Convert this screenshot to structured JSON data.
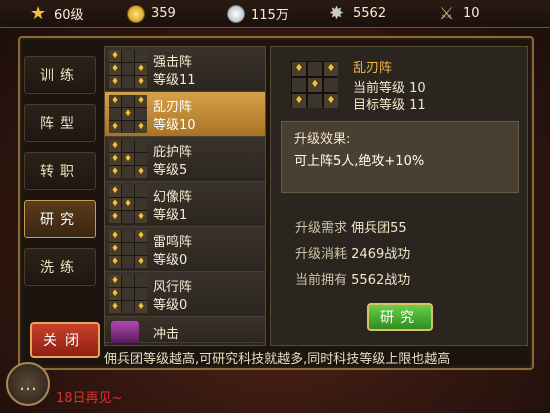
{
  "topbar": {
    "level": "60级",
    "gold": "359",
    "silver": "115万",
    "merit": "5562",
    "stamina": "10"
  },
  "tabs": [
    {
      "label": "训练",
      "active": false
    },
    {
      "label": "阵型",
      "active": false
    },
    {
      "label": "转职",
      "active": false
    },
    {
      "label": "研究",
      "active": true
    },
    {
      "label": "洗练",
      "active": false
    }
  ],
  "close_label": "关闭",
  "formations": [
    {
      "name": "强击阵",
      "level": "等级11",
      "selected": false
    },
    {
      "name": "乱刃阵",
      "level": "等级10",
      "selected": true
    },
    {
      "name": "庇护阵",
      "level": "等级5",
      "selected": false
    },
    {
      "name": "幻像阵",
      "level": "等级1",
      "selected": false
    },
    {
      "name": "雷鸣阵",
      "level": "等级0",
      "selected": false
    },
    {
      "name": "风行阵",
      "level": "等级0",
      "selected": false
    },
    {
      "name": "冲击",
      "level": "",
      "selected": false
    }
  ],
  "detail": {
    "name": "乱刃阵",
    "current_level": "当前等级 10",
    "target_level": "目标等级 11",
    "effect_title": "升级效果:",
    "effect_text": "可上阵5人,绝攻+10%",
    "req_label": "升级需求",
    "req_value": "佣兵团55",
    "cost_label": "升级消耗",
    "cost_value": "2469战功",
    "own_label": "当前拥有",
    "own_value": "5562战功",
    "research_label": "研究"
  },
  "hint": "佣兵团等级越高,可研究科技就越多,同时科技等级上限也越高",
  "chat_red": "18日再见~"
}
